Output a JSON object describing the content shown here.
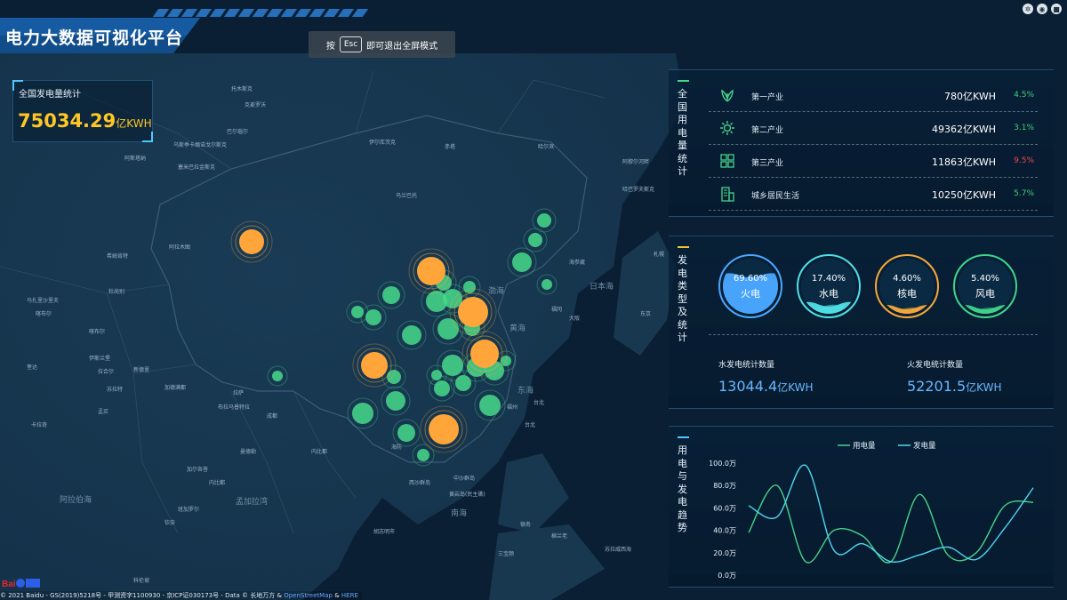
{
  "header": {
    "title": "电力大数据可视化平台",
    "esc_prefix": "按",
    "esc_key": "Esc",
    "esc_suffix": "即可退出全屏模式"
  },
  "total": {
    "label": "全国发电量统计",
    "value": "75034.29",
    "unit": "亿KWH"
  },
  "usage_panel": {
    "title": "全国用电量统计",
    "rows": [
      {
        "name": "第一产业",
        "value": "780亿KWH",
        "pct": "4.5%",
        "pct_color": "#3fd07a",
        "icon": "leaf-icon"
      },
      {
        "name": "第二产业",
        "value": "49362亿KWH",
        "pct": "3.1%",
        "pct_color": "#3fd07a",
        "icon": "gear-icon"
      },
      {
        "name": "第三产业",
        "value": "11863亿KWH",
        "pct": "9.5%",
        "pct_color": "#e84a4a",
        "icon": "grid-icon"
      },
      {
        "name": "城乡居民生活",
        "value": "10250亿KWH",
        "pct": "5.7%",
        "pct_color": "#3fd07a",
        "icon": "building-icon"
      }
    ]
  },
  "types_panel": {
    "title": "发电类型及统计",
    "rings": [
      {
        "pct": "69.60%",
        "label": "火电",
        "color": "#4aa8ff",
        "level": 0.696
      },
      {
        "pct": "17.40%",
        "label": "水电",
        "color": "#4fe0e6",
        "level": 0.174
      },
      {
        "pct": "4.60%",
        "label": "核电",
        "color": "#f5a93b",
        "level": 0.046
      },
      {
        "pct": "5.40%",
        "label": "风电",
        "color": "#3fd58c",
        "level": 0.054
      }
    ],
    "hydro_label": "水发电统计数量",
    "hydro_value": "13044.4",
    "thermal_label": "火发电统计数量",
    "thermal_value": "52201.5",
    "unit": "亿KWH"
  },
  "trend_panel": {
    "title": "用电与发电趋势",
    "legend": [
      {
        "name": "用电量",
        "color": "#47d38a"
      },
      {
        "name": "发电量",
        "color": "#4fd6f0"
      }
    ]
  },
  "chart_data": {
    "type": "line",
    "title": "",
    "xlabel": "",
    "ylabel": "",
    "ylim": [
      0,
      100
    ],
    "y_ticks": [
      "100.0万",
      "80.0万",
      "60.0万",
      "40.0万",
      "20.0万",
      "0.0万"
    ],
    "x": [
      0,
      1,
      2,
      3,
      4,
      5,
      6,
      7,
      8,
      9,
      10
    ],
    "series": [
      {
        "name": "用电量",
        "color": "#47d38a",
        "values": [
          38,
          80,
          12,
          40,
          35,
          12,
          72,
          18,
          20,
          62,
          65
        ]
      },
      {
        "name": "发电量",
        "color": "#4fd6f0",
        "values": [
          62,
          52,
          98,
          22,
          28,
          12,
          18,
          25,
          14,
          42,
          78
        ]
      }
    ]
  },
  "map": {
    "seas": [
      "阿拉伯海",
      "孟加拉湾",
      "南海",
      "东海",
      "黄海",
      "渤海",
      "日本海"
    ],
    "copyright_pre": "© 2021 Baidu - GS(2019)5218号 - 甲测资字1100930 - 京ICP证030173号 - Data © 长地万方 &",
    "copyright_osm": "OpenStreetMap",
    "copyright_amp": "&",
    "copyright_here": "HERE"
  }
}
